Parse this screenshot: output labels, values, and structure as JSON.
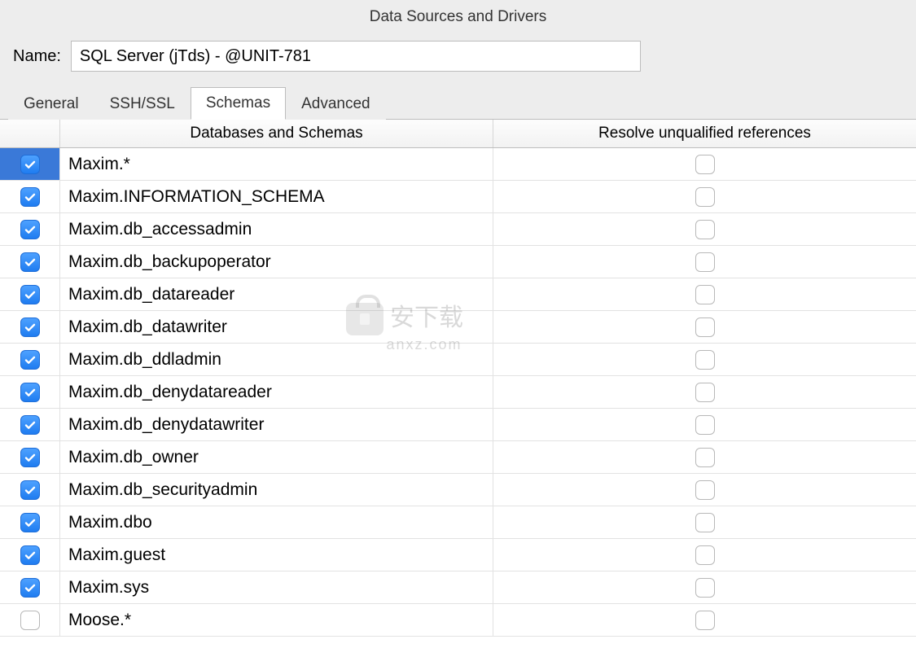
{
  "dialog": {
    "title": "Data Sources and Drivers",
    "name_label": "Name:",
    "name_value": "SQL Server (jTds) - @UNIT-781"
  },
  "tabs": [
    {
      "label": "General",
      "active": false
    },
    {
      "label": "SSH/SSL",
      "active": false
    },
    {
      "label": "Schemas",
      "active": true
    },
    {
      "label": "Advanced",
      "active": false
    }
  ],
  "table": {
    "headers": {
      "schemas": "Databases and Schemas",
      "resolve": "Resolve unqualified references"
    },
    "rows": [
      {
        "checked": true,
        "selected": true,
        "name": "Maxim.*",
        "resolve": false
      },
      {
        "checked": true,
        "selected": false,
        "name": "Maxim.INFORMATION_SCHEMA",
        "resolve": false
      },
      {
        "checked": true,
        "selected": false,
        "name": "Maxim.db_accessadmin",
        "resolve": false
      },
      {
        "checked": true,
        "selected": false,
        "name": "Maxim.db_backupoperator",
        "resolve": false
      },
      {
        "checked": true,
        "selected": false,
        "name": "Maxim.db_datareader",
        "resolve": false
      },
      {
        "checked": true,
        "selected": false,
        "name": "Maxim.db_datawriter",
        "resolve": false
      },
      {
        "checked": true,
        "selected": false,
        "name": "Maxim.db_ddladmin",
        "resolve": false
      },
      {
        "checked": true,
        "selected": false,
        "name": "Maxim.db_denydatareader",
        "resolve": false
      },
      {
        "checked": true,
        "selected": false,
        "name": "Maxim.db_denydatawriter",
        "resolve": false
      },
      {
        "checked": true,
        "selected": false,
        "name": "Maxim.db_owner",
        "resolve": false
      },
      {
        "checked": true,
        "selected": false,
        "name": "Maxim.db_securityadmin",
        "resolve": false
      },
      {
        "checked": true,
        "selected": false,
        "name": "Maxim.dbo",
        "resolve": false
      },
      {
        "checked": true,
        "selected": false,
        "name": "Maxim.guest",
        "resolve": false
      },
      {
        "checked": true,
        "selected": false,
        "name": "Maxim.sys",
        "resolve": false
      },
      {
        "checked": false,
        "selected": false,
        "name": "Moose.*",
        "resolve": false
      }
    ]
  },
  "watermark": {
    "main": "安下载",
    "sub": "anxz.com"
  }
}
